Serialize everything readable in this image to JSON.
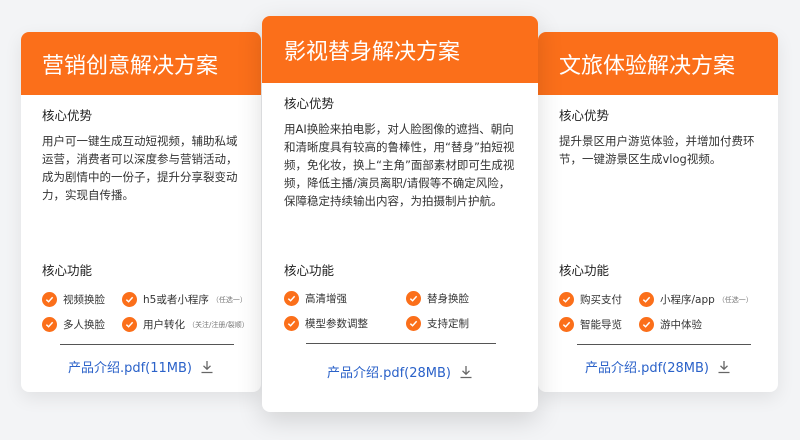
{
  "cards": [
    {
      "title": "营销创意解决方案",
      "advantage_label": "核心优势",
      "advantage_text": "用户可一键生成互动短视频，辅助私域运营，消费者可以深度参与营销活动，成为剧情中的一份子，提升分享裂变动力，实现自传播。",
      "features_label": "核心功能",
      "features": [
        {
          "label": "视频换脸",
          "note": ""
        },
        {
          "label": "h5或者小程序",
          "note": "（任选一）"
        },
        {
          "label": "多人换脸",
          "note": ""
        },
        {
          "label": "用户转化",
          "note": "（关注/注册/裂顺）"
        }
      ],
      "pdf_label": "产品介绍.pdf(11MB)"
    },
    {
      "title": "影视替身解决方案",
      "advantage_label": "核心优势",
      "advantage_text": "用AI换脸来拍电影，对人脸图像的遮挡、朝向和清晰度具有较高的鲁棒性，用“替身”拍短视频，免化妆，换上“主角”面部素材即可生成视频，降低主播/演员离职/请假等不确定风险，保障稳定持续输出内容，为拍摄制片护航。",
      "features_label": "核心功能",
      "features": [
        {
          "label": "高清增强",
          "note": ""
        },
        {
          "label": "替身换脸",
          "note": ""
        },
        {
          "label": "模型参数调整",
          "note": ""
        },
        {
          "label": "支持定制",
          "note": ""
        }
      ],
      "pdf_label": "产品介绍.pdf(28MB)"
    },
    {
      "title": "文旅体验解决方案",
      "advantage_label": "核心优势",
      "advantage_text": "提升景区用户游览体验，并增加付费环节，一键游景区生成vlog视频。",
      "features_label": "核心功能",
      "features": [
        {
          "label": "购买支付",
          "note": ""
        },
        {
          "label": "小程序/app",
          "note": "（任选一）"
        },
        {
          "label": "智能导览",
          "note": ""
        },
        {
          "label": "游中体验",
          "note": ""
        }
      ],
      "pdf_label": "产品介绍.pdf(28MB)"
    }
  ],
  "colors": {
    "accent": "#fb6f1a",
    "link": "#2b62c9"
  },
  "icons": {
    "check": "check-icon",
    "download": "download-icon"
  }
}
